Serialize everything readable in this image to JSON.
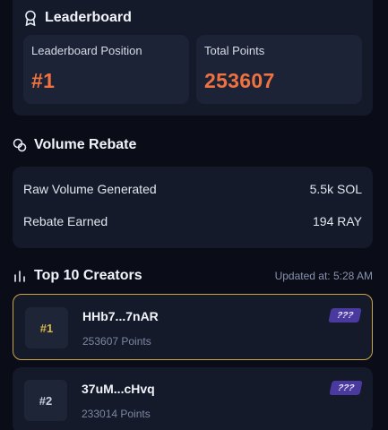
{
  "leaderboard": {
    "title": "Leaderboard",
    "position_label": "Leaderboard Position",
    "position_value": "#1",
    "points_label": "Total Points",
    "points_value": "253607"
  },
  "volume_rebate": {
    "title": "Volume Rebate",
    "rows": [
      {
        "label": "Raw Volume Generated",
        "value": "5.5k SOL"
      },
      {
        "label": "Rebate Earned",
        "value": "194 RAY"
      }
    ]
  },
  "top_creators": {
    "title": "Top 10 Creators",
    "updated": "Updated at: 5:28 AM",
    "items": [
      {
        "rank": "#1",
        "name": "HHb7...7nAR",
        "points": "253607 Points",
        "badge": "???"
      },
      {
        "rank": "#2",
        "name": "37uM...cHvq",
        "points": "233014 Points",
        "badge": "???"
      }
    ]
  },
  "colors": {
    "accent": "#f07240",
    "gold": "#c9a54a",
    "badge": "#4a3aa0",
    "card": "#141a2a",
    "background": "#0a0d18"
  },
  "icons": [
    "award-icon",
    "coins-icon",
    "bar-chart-icon"
  ]
}
